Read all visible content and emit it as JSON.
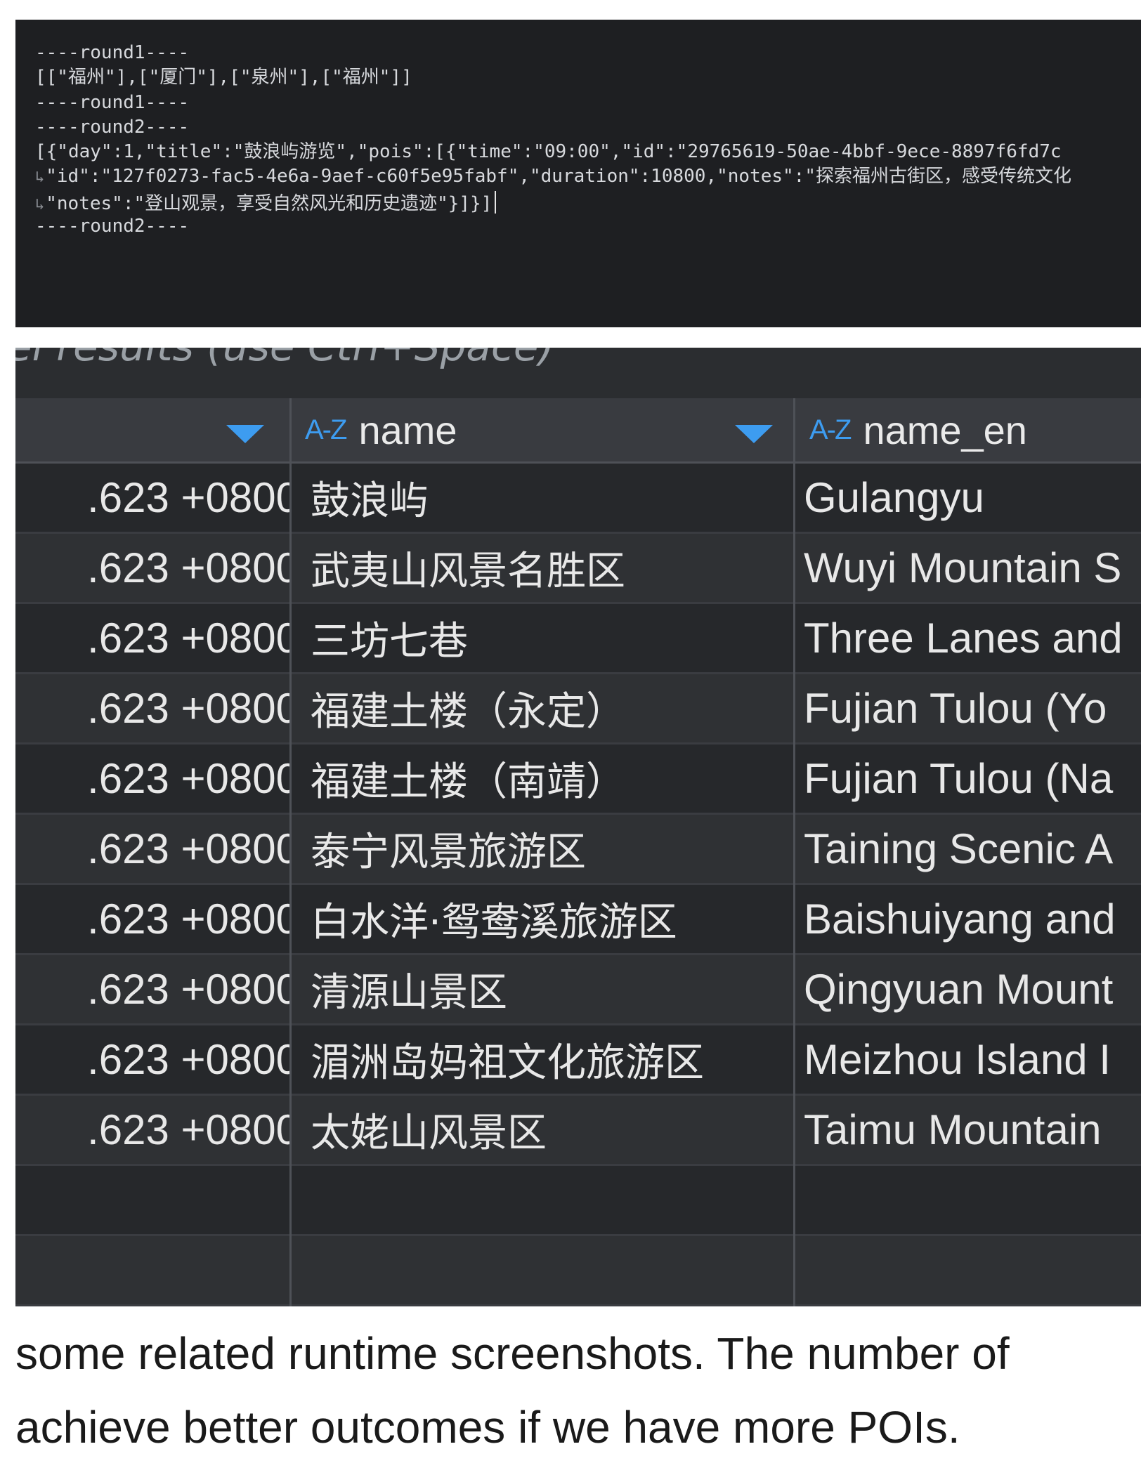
{
  "console": {
    "lines": [
      "----round1----",
      "[[\"福州\"],[\"厦门\"],[\"泉州\"],[\"福州\"]]",
      "----round1----",
      "----round2----",
      "[{\"day\":1,\"title\":\"鼓浪屿游览\",\"pois\":[{\"time\":\"09:00\",\"id\":\"29765619-50ae-4bbf-9ece-8897f6fd7c",
      "\"id\":\"127f0273-fac5-4e6a-9aef-c60f5e95fabf\",\"duration\":10800,\"notes\":\"探索福州古街区，感受传统文化",
      "\"notes\":\"登山观景，享受自然风光和历史遗迹\"}]}]",
      "----round2----"
    ]
  },
  "grid": {
    "caption_clipped": "el results (use Ctrl+Space)",
    "headers": [
      {
        "label": "",
        "icon": "sort-arrow"
      },
      {
        "label": "name",
        "icon": "az-icon",
        "type_label": "A-Z"
      },
      {
        "label": "name_en",
        "icon": "az-icon",
        "type_label": "A-Z"
      }
    ],
    "rows": [
      {
        "ts": ".623 +0800",
        "name": "鼓浪屿",
        "name_en": "Gulangyu"
      },
      {
        "ts": ".623 +0800",
        "name": "武夷山风景名胜区",
        "name_en": "Wuyi Mountain S"
      },
      {
        "ts": ".623 +0800",
        "name": "三坊七巷",
        "name_en": "Three Lanes and"
      },
      {
        "ts": ".623 +0800",
        "name": "福建土楼（永定）",
        "name_en": "Fujian Tulou (Yo"
      },
      {
        "ts": ".623 +0800",
        "name": "福建土楼（南靖）",
        "name_en": "Fujian Tulou (Na"
      },
      {
        "ts": ".623 +0800",
        "name": "泰宁风景旅游区",
        "name_en": "Taining Scenic A"
      },
      {
        "ts": ".623 +0800",
        "name": "白水洋·鸳鸯溪旅游区",
        "name_en": "Baishuiyang and"
      },
      {
        "ts": ".623 +0800",
        "name": "清源山景区",
        "name_en": "Qingyuan Mount"
      },
      {
        "ts": ".623 +0800",
        "name": "湄洲岛妈祖文化旅游区",
        "name_en": "Meizhou Island I"
      },
      {
        "ts": ".623 +0800",
        "name": "太姥山风景区",
        "name_en": "Taimu Mountain"
      }
    ],
    "empty_rows": 2
  },
  "caption": {
    "line1": "some related runtime screenshots. The number of",
    "line2": "achieve better outcomes if we have more POIs."
  },
  "colors": {
    "console_bg": "#1e1f22",
    "grid_bg": "#2b2d30",
    "accent": "#3d9cf0"
  }
}
